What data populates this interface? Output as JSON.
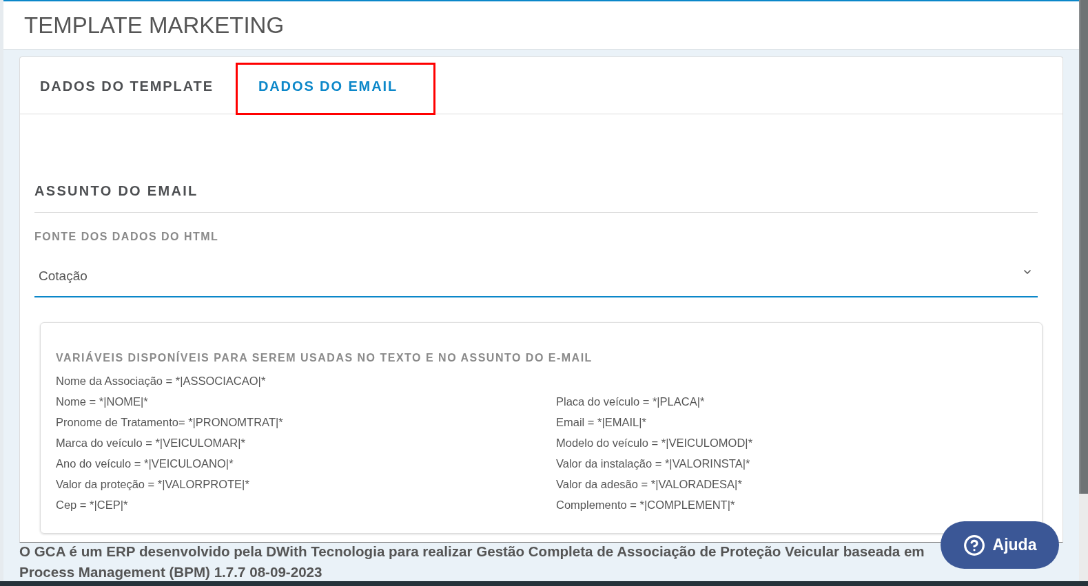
{
  "header": {
    "title": "TEMPLATE MARKETING"
  },
  "tabs": [
    {
      "label": "DADOS DO TEMPLATE",
      "selected": false,
      "highlighted": false
    },
    {
      "label": "DADOS DO EMAIL",
      "selected": true,
      "highlighted": true
    }
  ],
  "subject_section": {
    "title": "ASSUNTO DO EMAIL"
  },
  "data_source": {
    "label": "FONTE DOS DADOS DO HTML",
    "value": "Cotação"
  },
  "variables": {
    "title": "VARIÁVEIS DISPONÍVEIS PARA SEREM USADAS NO TEXTO E NO ASSUNTO DO E-MAIL",
    "lead": "Nome da Associação = *|ASSOCIACAO|*",
    "columns": [
      [
        "Nome = *|NOME|*",
        "Pronome de Tratamento= *|PRONOMTRAT|*",
        "Marca do veículo = *|VEICULOMAR|*",
        "Ano do veículo = *|VEICULOANO|*",
        "Valor da proteção = *|VALORPROTE|*",
        "Cep = *|CEP|*"
      ],
      [
        "Placa do veículo = *|PLACA|*",
        "Email = *|EMAIL|*",
        "Modelo do veículo = *|VEICULOMOD|*",
        "Valor da instalação = *|VALORINSTA|*",
        "Valor da adesão = *|VALORADESA|*",
        "Complemento = *|COMPLEMENT|*"
      ]
    ]
  },
  "footer": {
    "lines": [
      "O GCA é um ERP desenvolvido pela DWith Tecnologia para realizar Gestão Completa de Associação de Proteção Veicular baseada em",
      "Process Management (BPM) 1.7.7 08-09-2023"
    ]
  },
  "help_button": {
    "label": "Ajuda"
  }
}
